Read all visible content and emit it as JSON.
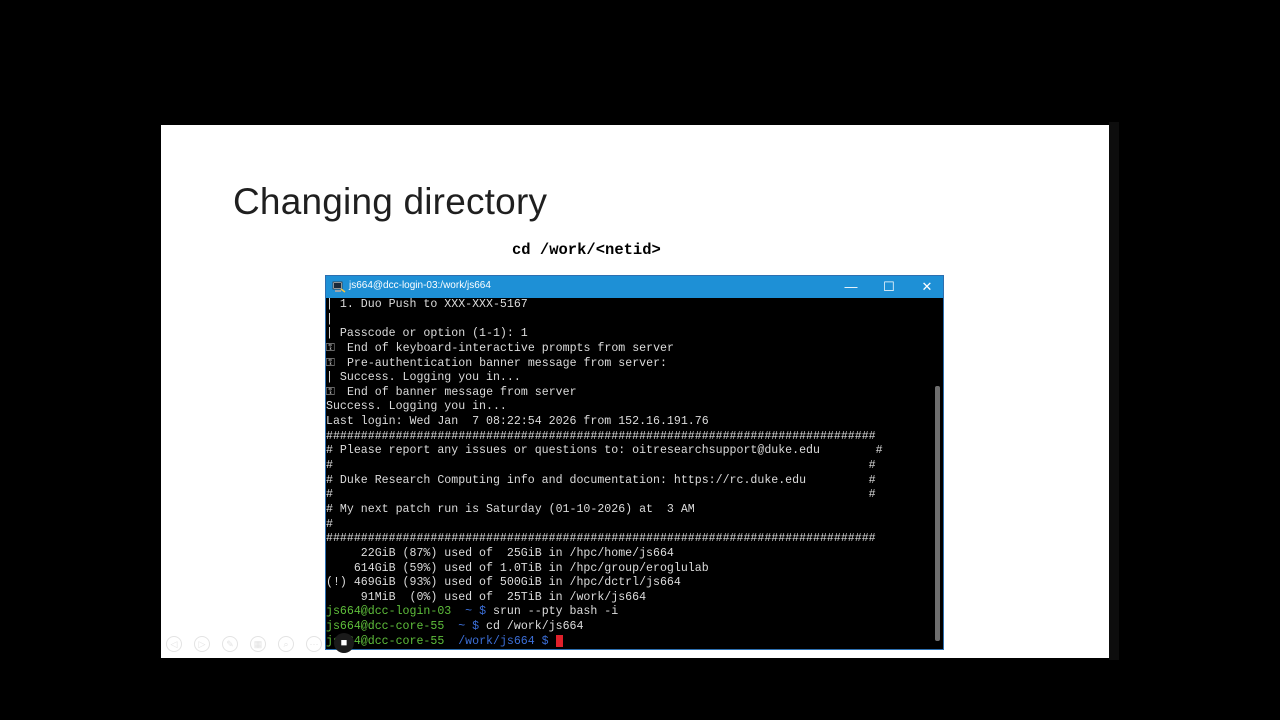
{
  "slide": {
    "title": "Changing directory",
    "command": "cd /work/<netid>"
  },
  "terminal": {
    "window_title": "js664@dcc-login-03:/work/js664",
    "controls": {
      "minimize": "—",
      "maximize": "☐",
      "close": "✕"
    },
    "lines": [
      {
        "prefix": "",
        "text": "| 1. Duo Push to XXX-XXX-5167"
      },
      {
        "prefix": "",
        "text": "|"
      },
      {
        "prefix": "",
        "text": "| Passcode or option (1-1): 1"
      },
      {
        "prefix": "key",
        "text": " End of keyboard-interactive prompts from server"
      },
      {
        "prefix": "key",
        "text": " Pre-authentication banner message from server:"
      },
      {
        "prefix": "",
        "text": "| Success. Logging you in..."
      },
      {
        "prefix": "key",
        "text": " End of banner message from server"
      },
      {
        "prefix": "",
        "text": "Success. Logging you in..."
      },
      {
        "prefix": "",
        "text": "Last login: Wed Jan  7 08:22:54 2026 from 152.16.191.76"
      },
      {
        "prefix": "",
        "text": "###############################################################################"
      },
      {
        "prefix": "",
        "text": "# Please report any issues or questions to: oitresearchsupport@duke.edu        #"
      },
      {
        "prefix": "",
        "text": "#                                                                             #"
      },
      {
        "prefix": "",
        "text": "# Duke Research Computing info and documentation: https://rc.duke.edu         #"
      },
      {
        "prefix": "",
        "text": "#                                                                             #"
      },
      {
        "prefix": "",
        "text": "# My next patch run is Saturday (01-10-2026) at  3 AM"
      },
      {
        "prefix": "",
        "text": "#"
      },
      {
        "prefix": "",
        "text": "###############################################################################"
      },
      {
        "prefix": "",
        "text": "     22GiB (87%) used of  25GiB in /hpc/home/js664"
      },
      {
        "prefix": "",
        "text": "    614GiB (59%) used of 1.0TiB in /hpc/group/eroglulab"
      },
      {
        "prefix": "",
        "text": "(!) 469GiB (93%) used of 500GiB in /hpc/dctrl/js664"
      },
      {
        "prefix": "",
        "text": "     91MiB  (0%) used of  25TiB in /work/js664"
      }
    ],
    "prompts": [
      {
        "user": "js664@dcc-login-03",
        "path": "~",
        "cmd": " srun --pty bash -i"
      },
      {
        "user": "js664@dcc-core-55",
        "path": "~",
        "cmd": " cd /work/js664"
      },
      {
        "user": "js664@dcc-core-55",
        "path": "/work/js664",
        "cmd": " "
      }
    ]
  },
  "colors": {
    "titlebar": "#1e90d6",
    "prompt_user": "#5fbf3b",
    "prompt_path": "#3c6fd8",
    "cursor": "#e0202a"
  }
}
